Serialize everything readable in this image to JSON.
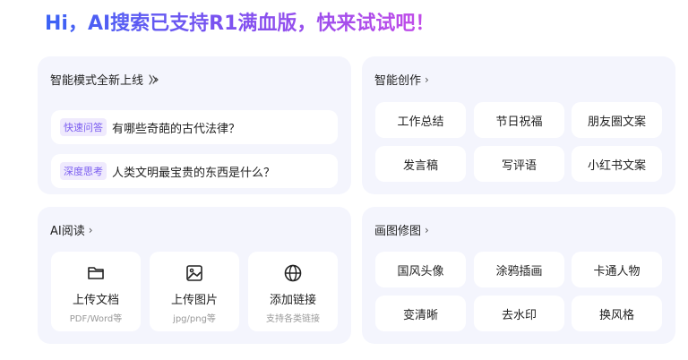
{
  "headline": "Hi，AI搜索已支持R1满血版，快来试试吧！",
  "smart_card": {
    "title": "智能模式全新上线",
    "items": [
      {
        "tag": "快速问答",
        "text": "有哪些奇葩的古代法律？"
      },
      {
        "tag": "深度思考",
        "text": "人类文明最宝贵的东西是什么？"
      }
    ]
  },
  "create_card": {
    "title": "智能创作",
    "chevron": "›",
    "items": [
      "工作总结",
      "节日祝福",
      "朋友圈文案",
      "发言稿",
      "写评语",
      "小红书文案"
    ]
  },
  "read_card": {
    "title": "AI阅读",
    "chevron": "›",
    "tiles": [
      {
        "icon": "folder-icon",
        "label": "上传文档",
        "sub": "PDF/Word等"
      },
      {
        "icon": "image-icon",
        "label": "上传图片",
        "sub": "jpg/png等"
      },
      {
        "icon": "globe-icon",
        "label": "添加链接",
        "sub": "支持各类链接"
      }
    ]
  },
  "draw_card": {
    "title": "画图修图",
    "chevron": "›",
    "items": [
      "国风头像",
      "涂鸦插画",
      "卡通人物",
      "变清晰",
      "去水印",
      "换风格"
    ]
  },
  "colors": {
    "card_bg": "#f4f5fd",
    "tag_purple": "#7a5cf0",
    "headline_gradient": [
      "#3b63f5",
      "#7a52f0",
      "#c64be8"
    ]
  }
}
